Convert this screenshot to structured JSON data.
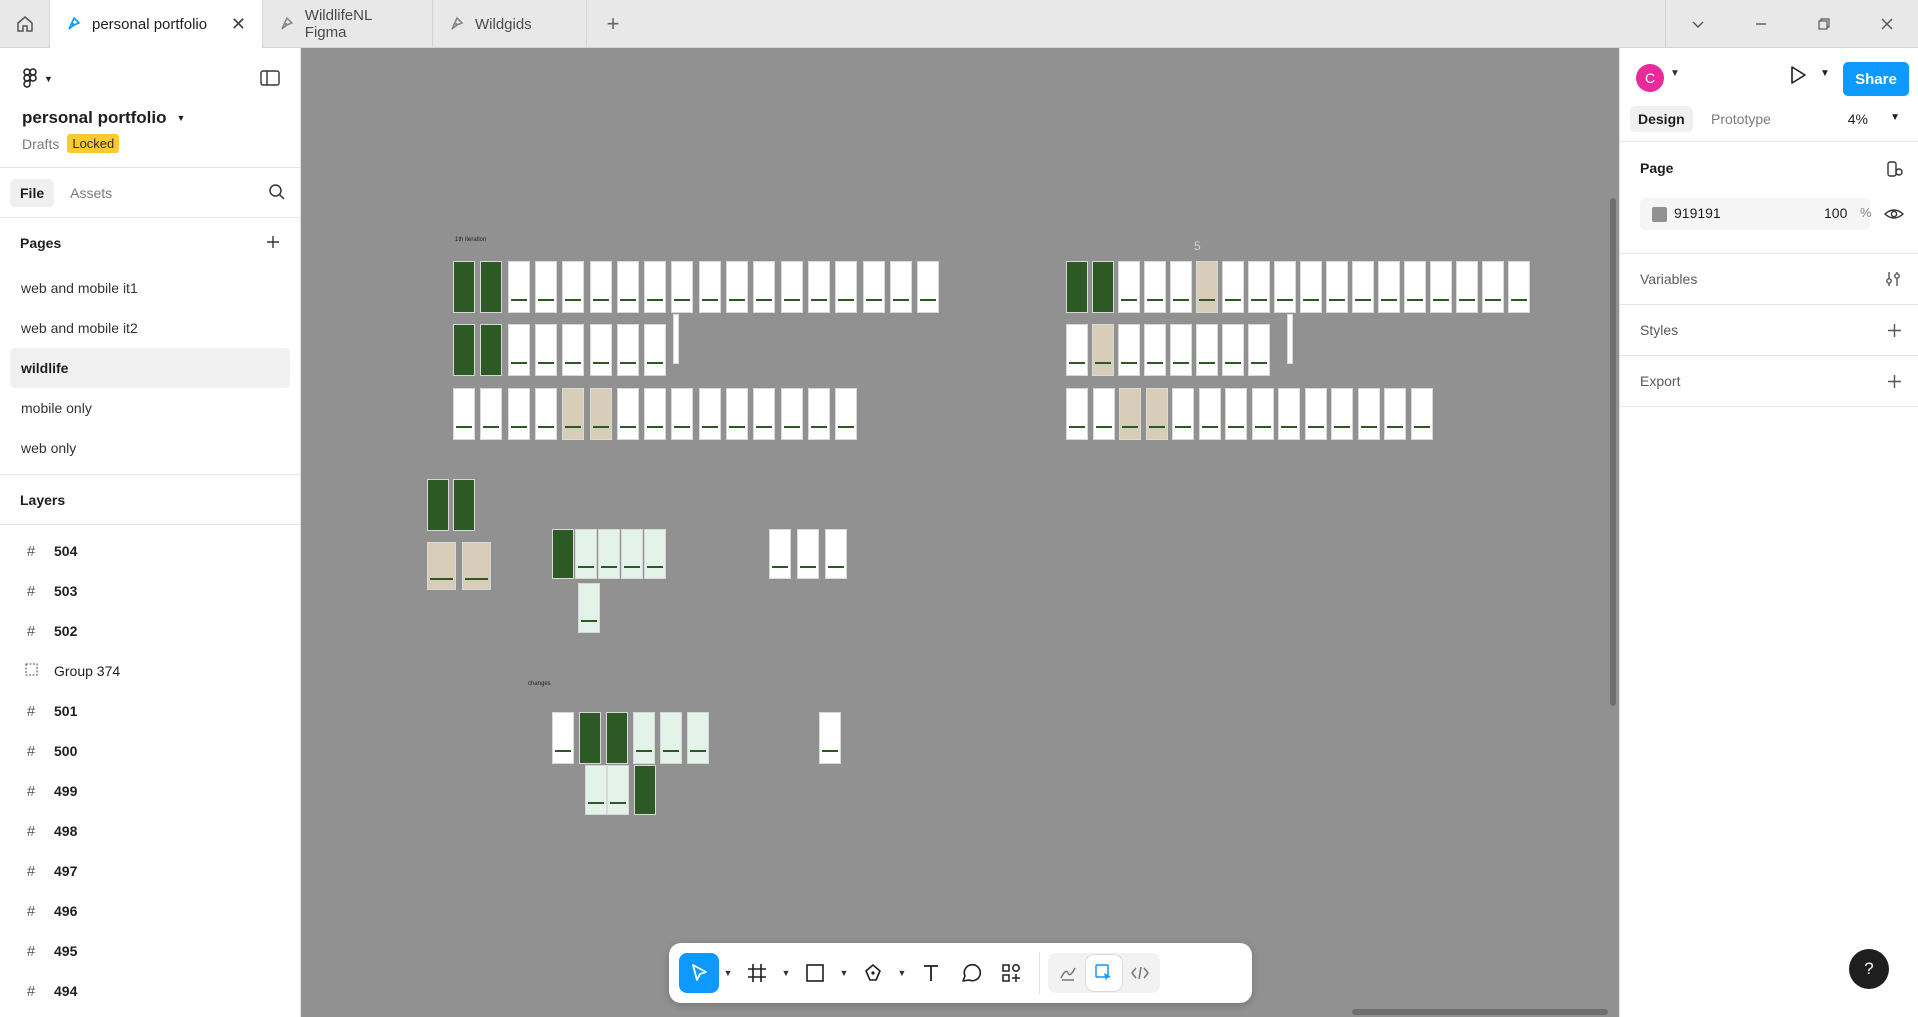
{
  "titlebar": {
    "tabs": [
      {
        "label": "personal portfolio",
        "active": true
      },
      {
        "label": "WildlifeNL Figma",
        "active": false
      },
      {
        "label": "Wildgids",
        "active": false
      }
    ]
  },
  "file": {
    "name": "personal portfolio",
    "location": "Drafts",
    "badge": "Locked"
  },
  "left_tabs": {
    "file": "File",
    "assets": "Assets"
  },
  "pages": {
    "title": "Pages",
    "items": [
      {
        "label": "web and mobile it1",
        "active": false
      },
      {
        "label": "web and mobile it2",
        "active": false
      },
      {
        "label": "wildlife",
        "active": true
      },
      {
        "label": "mobile only",
        "active": false
      },
      {
        "label": "web only",
        "active": false
      }
    ]
  },
  "layers": {
    "title": "Layers",
    "items": [
      {
        "label": "504",
        "type": "frame"
      },
      {
        "label": "503",
        "type": "frame"
      },
      {
        "label": "502",
        "type": "frame"
      },
      {
        "label": "Group 374",
        "type": "group"
      },
      {
        "label": "501",
        "type": "frame"
      },
      {
        "label": "500",
        "type": "frame"
      },
      {
        "label": "499",
        "type": "frame"
      },
      {
        "label": "498",
        "type": "frame"
      },
      {
        "label": "497",
        "type": "frame"
      },
      {
        "label": "496",
        "type": "frame"
      },
      {
        "label": "495",
        "type": "frame"
      },
      {
        "label": "494",
        "type": "frame"
      }
    ]
  },
  "right_panel": {
    "avatar_initial": "C",
    "share_label": "Share",
    "tabs": {
      "design": "Design",
      "prototype": "Prototype"
    },
    "zoom": "4%",
    "page_section": {
      "title": "Page",
      "fill_hex": "919191",
      "fill_opacity": "100",
      "percent_sign": "%",
      "fill_color": "#919191"
    },
    "sections": [
      "Variables",
      "Styles",
      "Export"
    ]
  },
  "canvas": {
    "background": "#919191",
    "labels": {
      "top_left": "1th iteration",
      "middle": "changes",
      "right_number": "5"
    }
  },
  "help_label": "?"
}
